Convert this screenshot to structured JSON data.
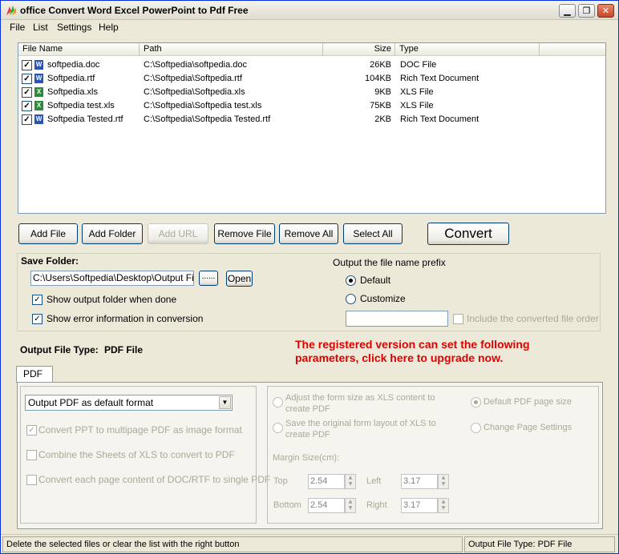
{
  "window": {
    "title": "office Convert Word Excel PowerPoint to Pdf Free",
    "minimize": "▁",
    "restore": "❐",
    "close": "✕"
  },
  "menu": [
    "File",
    "List",
    "Settings",
    "Help"
  ],
  "file_list": {
    "columns": [
      "File Name",
      "Path",
      "Size",
      "Type"
    ],
    "rows": [
      {
        "name": "softpedia.doc",
        "path": "C:\\Softpedia\\softpedia.doc",
        "size": "26KB",
        "type": "DOC File",
        "icon": "word"
      },
      {
        "name": "Softpedia.rtf",
        "path": "C:\\Softpedia\\Softpedia.rtf",
        "size": "104KB",
        "type": "Rich Text Document",
        "icon": "word"
      },
      {
        "name": "Softpedia.xls",
        "path": "C:\\Softpedia\\Softpedia.xls",
        "size": "9KB",
        "type": "XLS File",
        "icon": "excel"
      },
      {
        "name": "Softpedia test.xls",
        "path": "C:\\Softpedia\\Softpedia test.xls",
        "size": "75KB",
        "type": "XLS File",
        "icon": "excel"
      },
      {
        "name": "Softpedia Tested.rtf",
        "path": "C:\\Softpedia\\Softpedia Tested.rtf",
        "size": "2KB",
        "type": "Rich Text Document",
        "icon": "word"
      }
    ]
  },
  "buttons": {
    "add_file": "Add File",
    "add_folder": "Add Folder",
    "add_url": "Add URL",
    "remove_file": "Remove File",
    "remove_all": "Remove All",
    "select_all": "Select All",
    "convert": "Convert"
  },
  "save_folder": {
    "label": "Save Folder:",
    "path": "C:\\Users\\Softpedia\\Desktop\\Output Files",
    "browse": "......",
    "open": "Open",
    "show_output": "Show output folder when done",
    "show_error": "Show error information in conversion",
    "prefix_label": "Output the file name prefix",
    "default": "Default",
    "customize": "Customize",
    "include_order": "Include the converted file order"
  },
  "output_type": {
    "label": "Output File Type:",
    "value": "PDF File"
  },
  "upgrade": {
    "line1": "The registered version can set the following",
    "line2": "parameters, click here to upgrade now."
  },
  "pdf_tab": {
    "tab": "PDF",
    "format": "Output PDF as default format",
    "opt1": "Convert PPT to multipage PDF as image format",
    "opt2": "Combine the Sheets of XLS to convert to PDF",
    "opt3": "Convert each page content of DOC/RTF to single PDF"
  },
  "page_settings": {
    "adjust_line1": "Adjust the form size as XLS content to",
    "adjust_line2": "create PDF",
    "save_line1": "Save the original form layout of XLS to",
    "save_line2": "create PDF",
    "default_size": "Default PDF page size",
    "change": "Change Page Settings",
    "margin_label": "Margin Size(cm):",
    "top_label": "Top",
    "top_value": "2.54",
    "left_label": "Left",
    "left_value": "3.17",
    "bottom_label": "Bottom",
    "bottom_value": "2.54",
    "right_label": "Right",
    "right_value": "3.17"
  },
  "status": {
    "left": "Delete the selected files or clear the list with the right button",
    "right": "Output File Type:  PDF File"
  }
}
